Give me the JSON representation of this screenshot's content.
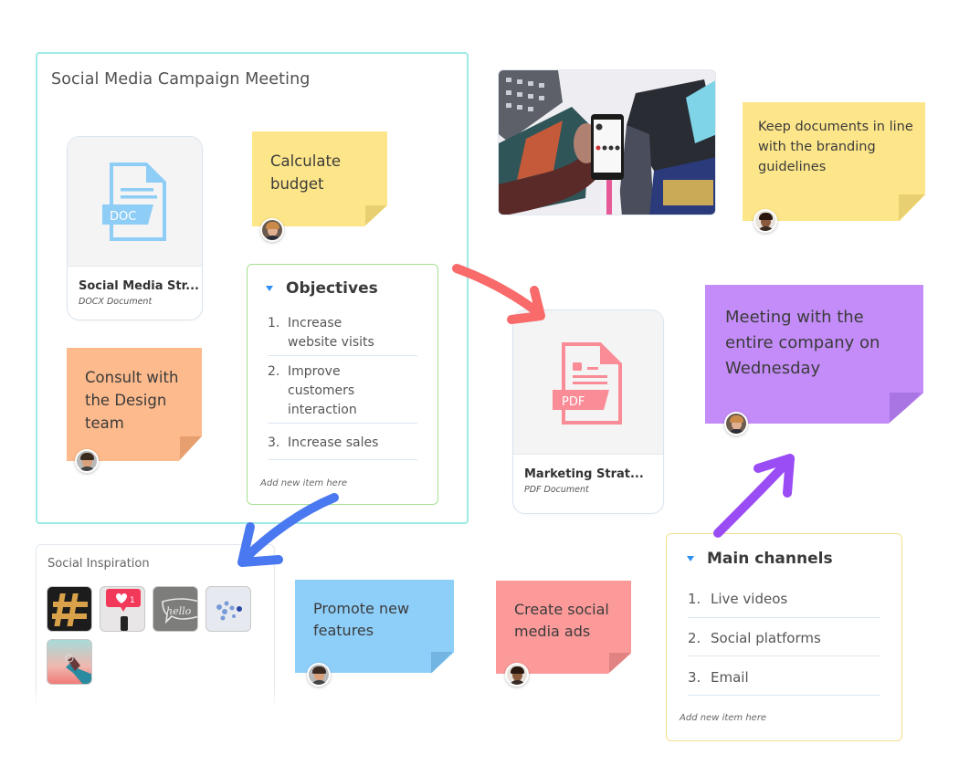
{
  "frame": {
    "title": "Social Media Campaign Meeting",
    "border_color": "#9eeae6"
  },
  "docs": [
    {
      "name": "Social Media Str...",
      "type": "DOCX Document",
      "badge": "DOC",
      "icon": "doc-file-icon",
      "color": "#8ecdf6"
    },
    {
      "name": "Marketing Strat...",
      "type": "PDF Document",
      "badge": "PDF",
      "icon": "pdf-file-icon",
      "color": "#f98c96"
    }
  ],
  "stickies": [
    {
      "id": "calculate-budget",
      "text": "Calculate budget",
      "color": "#fde68a",
      "fold": "#e8cf71",
      "avatar": "man-glasses"
    },
    {
      "id": "consult-design",
      "text": "Consult with the Design team",
      "color": "#fdba8c",
      "fold": "#e79f70",
      "avatar": "man-beard"
    },
    {
      "id": "branding-guidelines",
      "text": "Keep documents in line with the branding guidelines",
      "color": "#fde68a",
      "fold": "#e8cf71",
      "avatar": "woman"
    },
    {
      "id": "company-meeting",
      "text": "Meeting with the entire company on Wednesday",
      "color": "#c38cf8",
      "fold": "#a975e2",
      "avatar": "man-glasses"
    },
    {
      "id": "promote-features",
      "text": "Promote new features",
      "color": "#8ecffa",
      "fold": "#73b5e2",
      "avatar": "man-beard"
    },
    {
      "id": "social-ads",
      "text": "Create social media ads",
      "color": "#fc9a9a",
      "fold": "#e28383",
      "avatar": "woman"
    }
  ],
  "objectives": {
    "title": "Objectives",
    "border_color": "#a6e08f",
    "items": [
      {
        "num": "1.",
        "text": "Increase website visits"
      },
      {
        "num": "2.",
        "text": "Improve customers interaction"
      },
      {
        "num": "3.",
        "text": "Increase sales"
      }
    ],
    "add_placeholder": "Add new item here"
  },
  "channels": {
    "title": "Main channels",
    "border_color": "#f1df8e",
    "items": [
      {
        "num": "1.",
        "text": "Live videos"
      },
      {
        "num": "2.",
        "text": "Social platforms"
      },
      {
        "num": "3.",
        "text": "Email"
      }
    ],
    "add_placeholder": "Add new item here"
  },
  "inspiration": {
    "title": "Social Inspiration",
    "tiles": [
      "hashtag-image",
      "like-notification-image",
      "hello-neon-image",
      "social-icons-image",
      "hand-phone-image"
    ]
  },
  "photo": {
    "subject": "hand-holding-phone-city-image"
  },
  "arrows": [
    {
      "name": "arrow-objectives-to-pdf",
      "color": "#f96a6a"
    },
    {
      "name": "arrow-objectives-to-inspiration",
      "color": "#4a78f0"
    },
    {
      "name": "arrow-channels-to-meeting",
      "color": "#9a4cf5"
    }
  ],
  "accent": {
    "triangle": "#2d8ff0"
  }
}
